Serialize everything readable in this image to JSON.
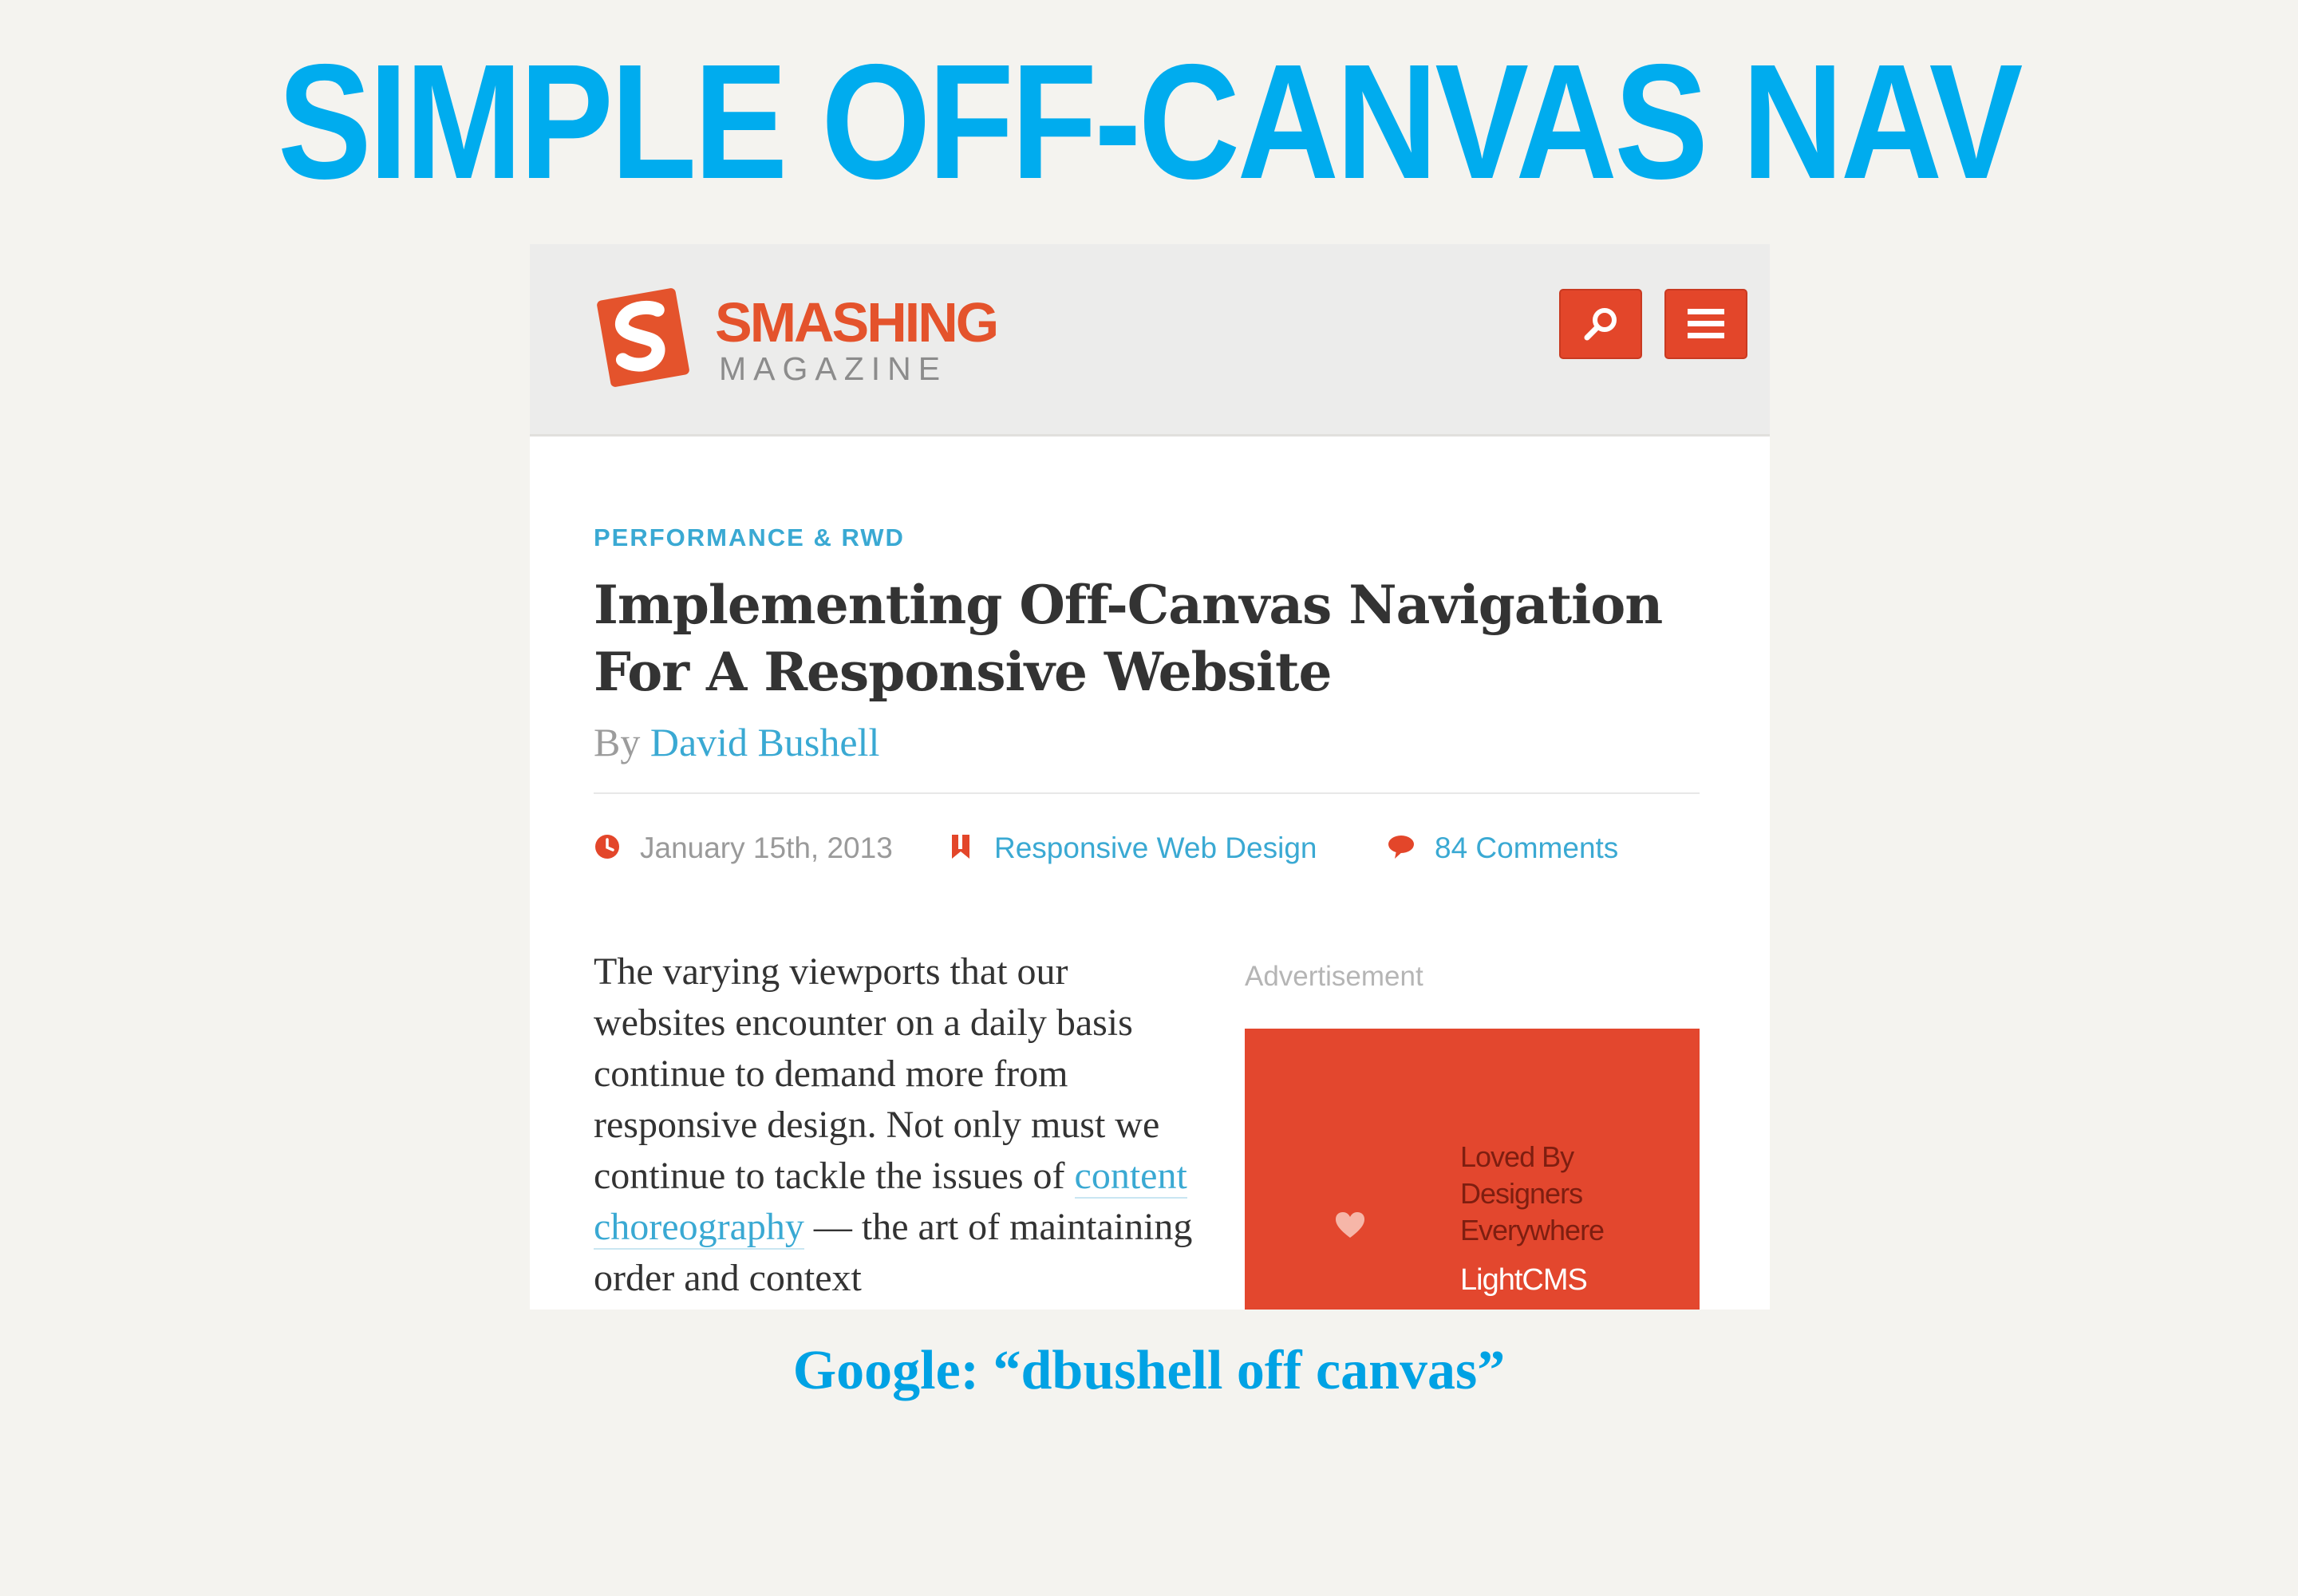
{
  "slide": {
    "title": "SIMPLE OFF-CANVAS NAV",
    "caption": "Google: “dbushell off canvas”"
  },
  "site": {
    "logo_word": "SMASHING",
    "logo_sub": "MAGAZINE",
    "buttons": {
      "search_icon": "search-icon",
      "menu_icon": "hamburger-menu-icon"
    }
  },
  "article": {
    "category": "PERFORMANCE & RWD",
    "title": "Implementing Off-Canvas Navigation For A Responsive Website",
    "byline_prefix": "By",
    "author": "David Bushell",
    "date": "January 15th, 2013",
    "tag": "Responsive Web Design",
    "comments": "84 Comments",
    "body_before_link": "The varying viewports that our websites encounter on a daily basis continue to demand more from responsive design. Not only must we continue to tackle the issues of ",
    "body_link": "content choreography",
    "body_after_link": " — the art of maintaining order and context"
  },
  "ad": {
    "label": "Advertisement",
    "copy": "Loved By Designers Everywhere",
    "brand": "LightCMS"
  },
  "colors": {
    "slide_title": "#00acee",
    "accent": "#e3462a",
    "link": "#3aa9d3",
    "background": "#f4f3ef"
  }
}
